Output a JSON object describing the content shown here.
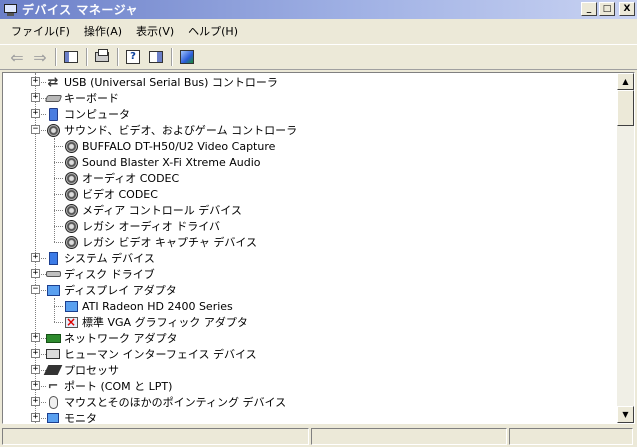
{
  "window": {
    "title": "デバイス マネージャ",
    "controls": {
      "minimize": "_",
      "maximize": "□",
      "close": "X"
    }
  },
  "menu": [
    {
      "label": "ファイル(F)"
    },
    {
      "label": "操作(A)"
    },
    {
      "label": "表示(V)"
    },
    {
      "label": "ヘルプ(H)"
    }
  ],
  "toolbar": {
    "back_icon": "back-arrow-icon",
    "forward_icon": "forward-arrow-icon",
    "buttons": [
      "properties-icon",
      "print-icon",
      "help-icon",
      "show-hide-panel-icon",
      "scan-hardware-icon"
    ]
  },
  "tree": {
    "nodes": [
      {
        "label": "USB (Universal Serial Bus) コントローラ",
        "icon": "usb-icon",
        "expanded": false
      },
      {
        "label": "キーボード",
        "icon": "keyboard-icon",
        "expanded": false
      },
      {
        "label": "コンピュータ",
        "icon": "computer-icon",
        "expanded": false
      },
      {
        "label": "サウンド、ビデオ、およびゲーム コントローラ",
        "icon": "speaker-icon",
        "expanded": true
      },
      {
        "label": "BUFFALO DT-H50/U2 Video Capture",
        "icon": "speaker-icon",
        "child": true
      },
      {
        "label": "Sound Blaster X-Fi Xtreme Audio",
        "icon": "speaker-icon",
        "child": true
      },
      {
        "label": "オーディオ CODEC",
        "icon": "speaker-icon",
        "child": true
      },
      {
        "label": "ビデオ CODEC",
        "icon": "speaker-icon",
        "child": true
      },
      {
        "label": "メディア コントロール デバイス",
        "icon": "speaker-icon",
        "child": true
      },
      {
        "label": "レガシ オーディオ ドライバ",
        "icon": "speaker-icon",
        "child": true
      },
      {
        "label": "レガシ ビデオ キャプチャ デバイス",
        "icon": "speaker-icon",
        "child": true
      },
      {
        "label": "システム デバイス",
        "icon": "system-device-icon",
        "expanded": false
      },
      {
        "label": "ディスク ドライブ",
        "icon": "disk-drive-icon",
        "expanded": false
      },
      {
        "label": "ディスプレイ アダプタ",
        "icon": "display-adapter-icon",
        "expanded": true
      },
      {
        "label": "ATI Radeon HD 2400 Series",
        "icon": "display-adapter-icon",
        "child": true
      },
      {
        "label": "標準 VGA グラフィック アダプタ",
        "icon": "display-adapter-error-icon",
        "child": true
      },
      {
        "label": "ネットワーク アダプタ",
        "icon": "network-adapter-icon",
        "expanded": false
      },
      {
        "label": "ヒューマン インターフェイス デバイス",
        "icon": "human-interface-icon",
        "expanded": false
      },
      {
        "label": "プロセッサ",
        "icon": "processor-icon",
        "expanded": false
      },
      {
        "label": "ポート (COM と LPT)",
        "icon": "port-icon",
        "expanded": false
      },
      {
        "label": "マウスとそのほかのポインティング デバイス",
        "icon": "mouse-icon",
        "expanded": false
      },
      {
        "label": "モニタ",
        "icon": "monitor-icon",
        "expanded": false
      }
    ]
  },
  "scrollbar": {
    "up": "▲",
    "down": "▼"
  },
  "expander": {
    "collapsed": "+",
    "expanded": "−"
  }
}
